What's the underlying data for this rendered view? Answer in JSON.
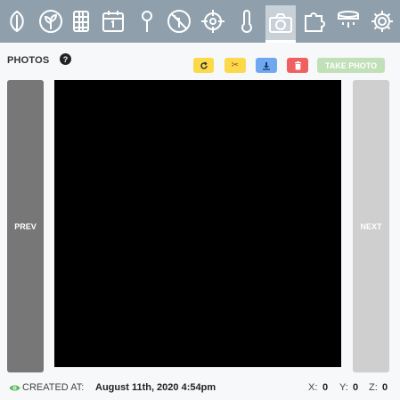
{
  "nav": {
    "items": [
      {
        "icon": "leaf-icon"
      },
      {
        "icon": "plants-icon"
      },
      {
        "icon": "garden-bed-icon"
      },
      {
        "icon": "calendar-icon"
      },
      {
        "icon": "pin-icon"
      },
      {
        "icon": "no-weeds-icon"
      },
      {
        "icon": "crosshair-icon"
      },
      {
        "icon": "thermometer-icon"
      },
      {
        "icon": "camera-icon",
        "active": true
      },
      {
        "icon": "puzzle-icon"
      },
      {
        "icon": "water-icon"
      },
      {
        "icon": "gear-icon"
      }
    ]
  },
  "photos": {
    "title": "PHOTOS",
    "help": "?",
    "take_photo": "TAKE PHOTO",
    "prev": "PREV",
    "next": "NEXT"
  },
  "footer": {
    "created_label": "CREATED AT:",
    "created_value": "August 11th, 2020 4:54pm",
    "x_label": "X:",
    "x_value": "0",
    "y_label": "Y:",
    "y_value": "0",
    "z_label": "Z:",
    "z_value": "0"
  },
  "colors": {
    "nav_bg": "#8fa0ac",
    "yellow": "#fcd949",
    "blue": "#6fa8f0",
    "red": "#ef6060",
    "green_disabled": "#c2e0b8",
    "prev_bg": "#777777",
    "next_bg": "#cfcfcf",
    "eye": "#5cb85c"
  }
}
